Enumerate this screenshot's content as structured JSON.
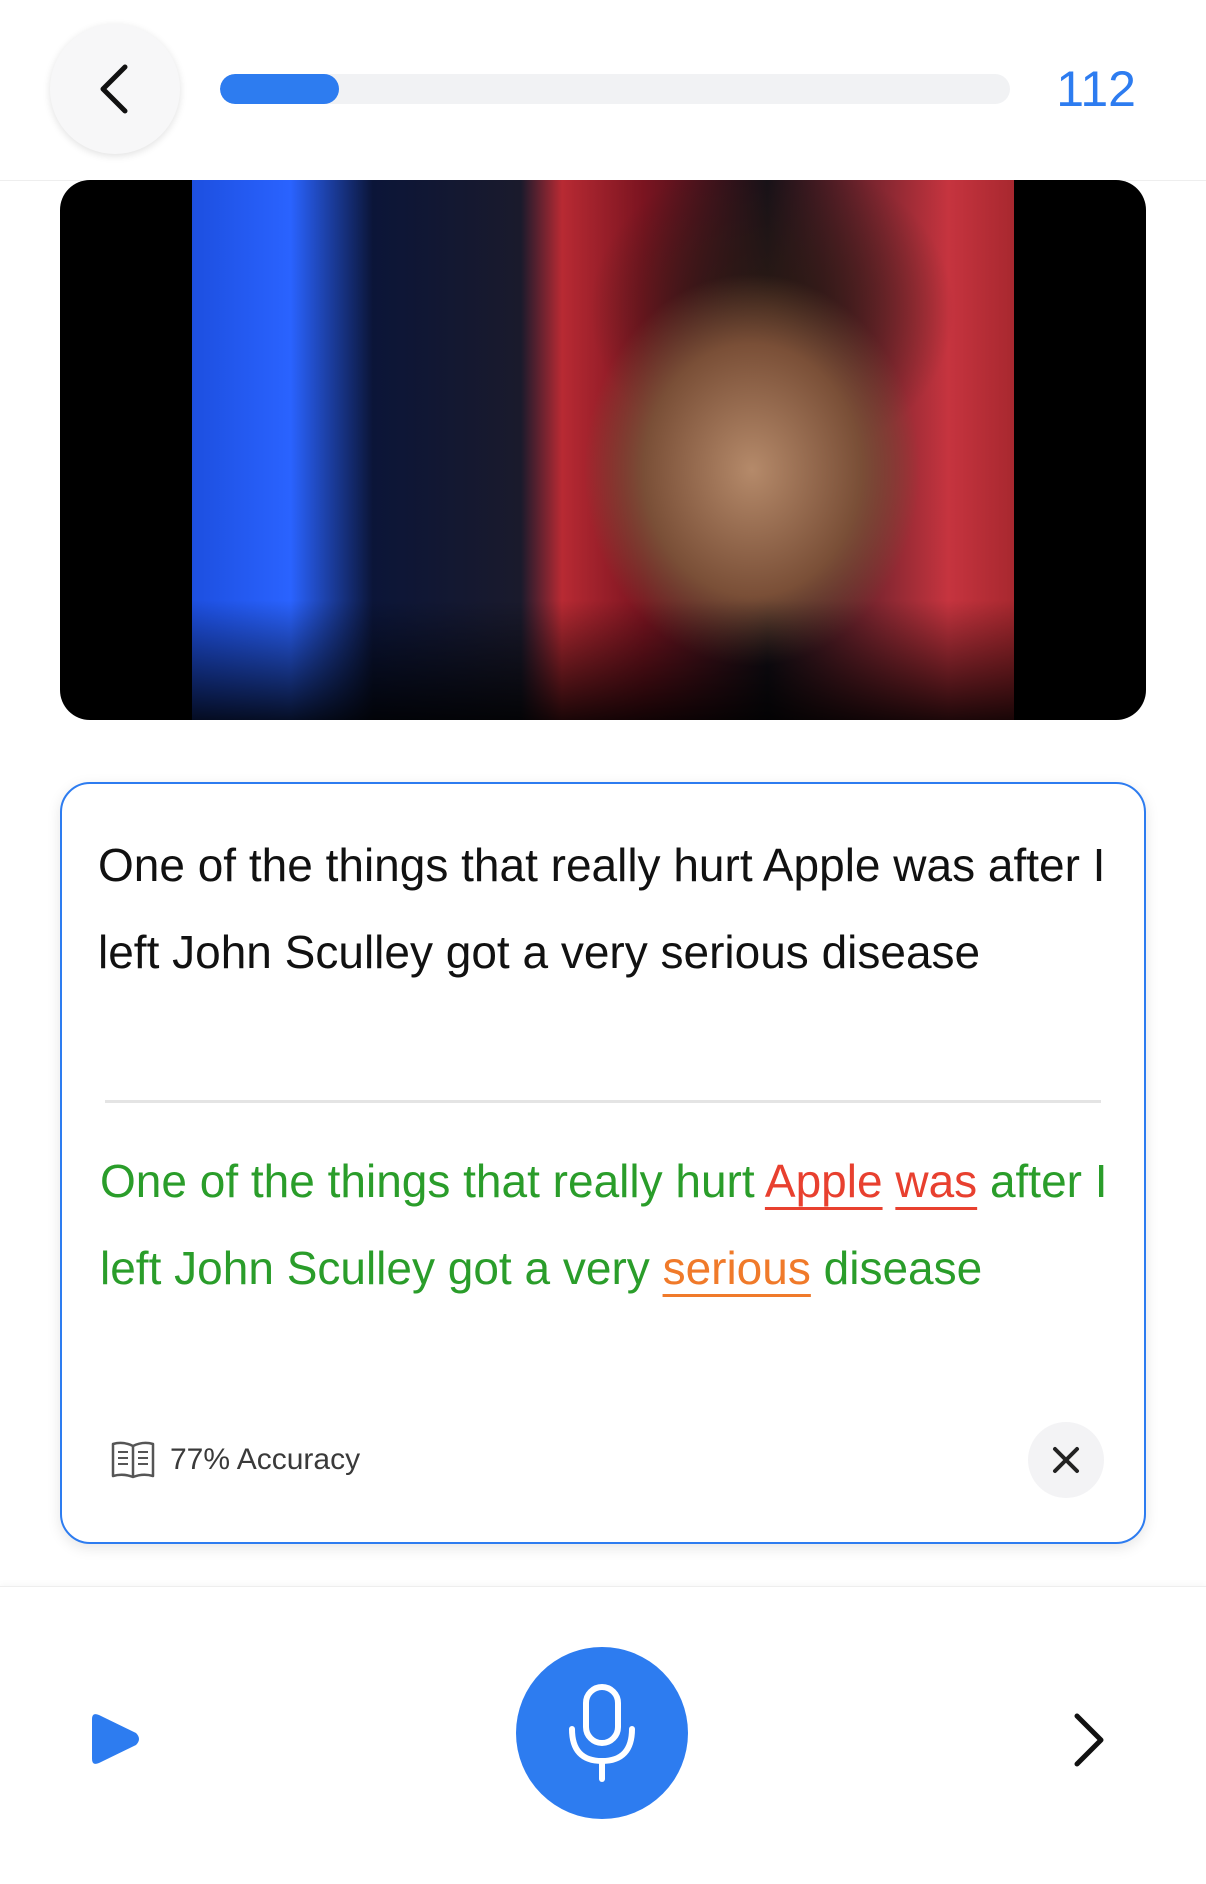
{
  "header": {
    "back_icon": "chevron-left-icon",
    "progress_fraction": 0.15,
    "counter": "112",
    "accent_color": "#2d7cf0"
  },
  "video": {
    "description_icon": "video-frame"
  },
  "transcript": {
    "original": "One of the things that really hurt Apple was after I left John Sculley got a very serious disease",
    "result_words": [
      {
        "text": "One",
        "status": "good"
      },
      {
        "text": "of",
        "status": "good"
      },
      {
        "text": "the",
        "status": "good"
      },
      {
        "text": "things",
        "status": "good"
      },
      {
        "text": "that",
        "status": "good"
      },
      {
        "text": "really",
        "status": "good"
      },
      {
        "text": "hurt",
        "status": "good"
      },
      {
        "text": "Apple",
        "status": "bad"
      },
      {
        "text": "was",
        "status": "bad"
      },
      {
        "text": "after",
        "status": "good"
      },
      {
        "text": "I",
        "status": "good"
      },
      {
        "text": "left",
        "status": "good"
      },
      {
        "text": "John",
        "status": "good"
      },
      {
        "text": "Sculley",
        "status": "good"
      },
      {
        "text": "got",
        "status": "good"
      },
      {
        "text": "a",
        "status": "good"
      },
      {
        "text": "very",
        "status": "good"
      },
      {
        "text": "serious",
        "status": "warn"
      },
      {
        "text": "disease",
        "status": "good"
      }
    ],
    "accuracy_label": "77% Accuracy",
    "accuracy_icon": "book-icon",
    "close_icon": "close-icon",
    "colors": {
      "good": "#2a9d2a",
      "bad": "#e8402f",
      "warn": "#f07a2a"
    }
  },
  "bottom_bar": {
    "play_icon": "play-icon",
    "mic_icon": "microphone-icon",
    "next_icon": "chevron-right-icon"
  }
}
